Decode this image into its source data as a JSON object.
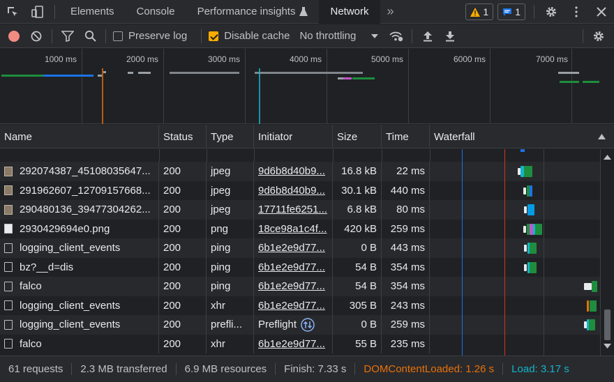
{
  "tabs": [
    {
      "label": "Elements"
    },
    {
      "label": "Console"
    },
    {
      "label": "Performance insights"
    },
    {
      "label": "Network"
    }
  ],
  "badges": {
    "warnings": "1",
    "messages": "1"
  },
  "toolbar": {
    "preserve_log": "Preserve log",
    "disable_cache": "Disable cache",
    "throttling": "No throttling"
  },
  "overview": {
    "ticks": [
      "1000 ms",
      "2000 ms",
      "3000 ms",
      "4000 ms",
      "5000 ms",
      "6000 ms",
      "7000 ms"
    ]
  },
  "columns": [
    "Name",
    "Status",
    "Type",
    "Initiator",
    "Size",
    "Time",
    "Waterfall"
  ],
  "rows": [
    {
      "name": "292074387_45108035647...",
      "status": "200",
      "type": "jpeg",
      "initiator": "9d6b8d40b9...",
      "size": "16.8 kB",
      "time": "22 ms",
      "icon": "img"
    },
    {
      "name": "291962607_12709157668...",
      "status": "200",
      "type": "jpeg",
      "initiator": "9d6b8d40b9...",
      "size": "30.1 kB",
      "time": "440 ms",
      "icon": "img"
    },
    {
      "name": "290480136_39477304262...",
      "status": "200",
      "type": "jpeg",
      "initiator": "17711fe6251...",
      "size": "6.8 kB",
      "time": "80 ms",
      "icon": "img"
    },
    {
      "name": "2930429694e0.png",
      "status": "200",
      "type": "png",
      "initiator": "18ce98a1c4f...",
      "size": "420 kB",
      "time": "259 ms",
      "icon": "png"
    },
    {
      "name": "logging_client_events",
      "status": "200",
      "type": "ping",
      "initiator": "6b1e2e9d77...",
      "size": "0 B",
      "time": "443 ms",
      "icon": "doc"
    },
    {
      "name": "bz?__d=dis",
      "status": "200",
      "type": "ping",
      "initiator": "6b1e2e9d77...",
      "size": "54 B",
      "time": "354 ms",
      "icon": "doc"
    },
    {
      "name": "falco",
      "status": "200",
      "type": "ping",
      "initiator": "6b1e2e9d77...",
      "size": "54 B",
      "time": "354 ms",
      "icon": "doc"
    },
    {
      "name": "logging_client_events",
      "status": "200",
      "type": "xhr",
      "initiator": "6b1e2e9d77...",
      "size": "305 B",
      "time": "243 ms",
      "icon": "doc"
    },
    {
      "name": "logging_client_events",
      "status": "200",
      "type": "prefli...",
      "initiator": "Preflight",
      "size": "0 B",
      "time": "259 ms",
      "icon": "doc"
    },
    {
      "name": "falco",
      "status": "200",
      "type": "xhr",
      "initiator": "6b1e2e9d77...",
      "size": "55 B",
      "time": "235 ms",
      "icon": "doc"
    }
  ],
  "status": {
    "requests": "61 requests",
    "transferred": "2.3 MB transferred",
    "resources": "6.9 MB resources",
    "finish": "Finish: 7.33 s",
    "dom_loaded": "DOMContentLoaded: 1.26 s",
    "load": "Load: 3.17 s"
  },
  "colors": {
    "dom": "#e8710a",
    "load": "#12b5cb",
    "accent": "#8ab4f8"
  }
}
